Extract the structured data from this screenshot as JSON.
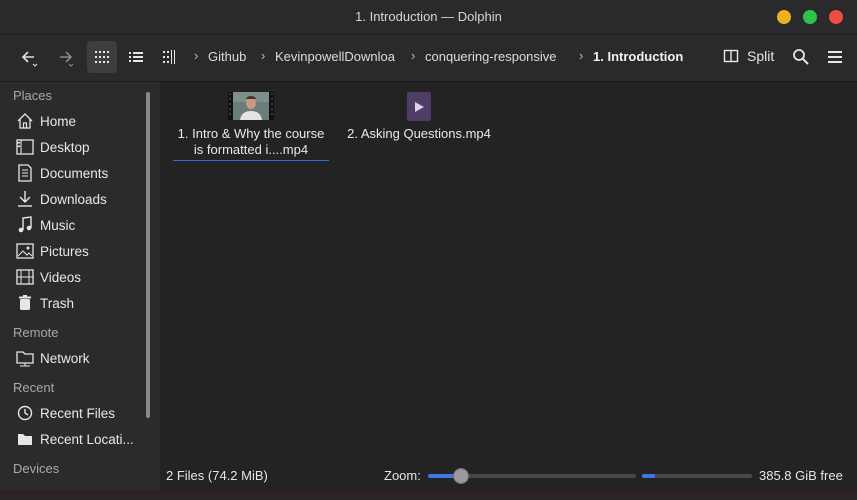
{
  "window": {
    "title": "1. Introduction — Dolphin"
  },
  "toolbar": {
    "breadcrumbs": [
      "Github",
      "KevinpowellDownloa",
      "conquering-responsive",
      "1. Introduction"
    ],
    "split_label": "Split"
  },
  "sidebar": {
    "sections": {
      "places": "Places",
      "remote": "Remote",
      "recent": "Recent",
      "devices": "Devices"
    },
    "places": [
      "Home",
      "Desktop",
      "Documents",
      "Downloads",
      "Music",
      "Pictures",
      "Videos",
      "Trash"
    ],
    "remote": [
      "Network"
    ],
    "recent": [
      "Recent Files",
      "Recent Locati..."
    ]
  },
  "files": [
    {
      "name_line1": "1. Intro & Why the course",
      "name_line2": "is formatted i....mp4",
      "icon": "video-thumbnail"
    },
    {
      "name": "2. Asking Questions.mp4",
      "icon": "video-file-icon"
    }
  ],
  "status": {
    "file_count": "2 Files (74.2 MiB)",
    "zoom_label": "Zoom:",
    "zoom_fraction": 0.16,
    "space_used_fraction": 0.12,
    "free_space": "385.8 GiB free"
  },
  "colors": {
    "accent": "#3d78e6",
    "close": "#ee4c45",
    "minimize": "#f0b21b",
    "maximize": "#2fc34a"
  }
}
